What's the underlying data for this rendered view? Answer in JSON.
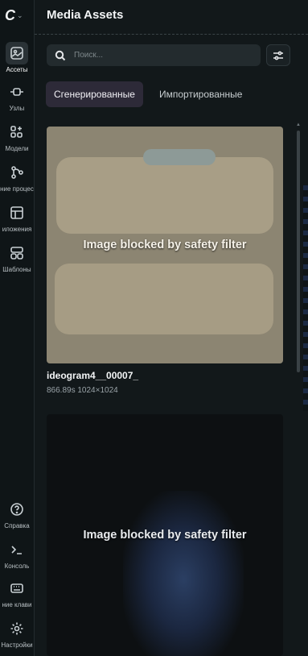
{
  "app": {
    "logo_text": "C",
    "chevron": "⌄"
  },
  "rail": {
    "items": [
      {
        "label": "Ассеты",
        "icon": "image-icon",
        "active": true
      },
      {
        "label": "Узлы",
        "icon": "node-icon"
      },
      {
        "label": "Модели",
        "icon": "models-icon"
      },
      {
        "label": "ние процес",
        "icon": "workflow-icon"
      },
      {
        "label": "иложения",
        "icon": "apps-icon"
      },
      {
        "label": "Шаблоны",
        "icon": "templates-icon"
      }
    ],
    "bottom_items": [
      {
        "label": "Справка",
        "icon": "help-icon"
      },
      {
        "label": "Консоль",
        "icon": "terminal-icon"
      },
      {
        "label": "ние клави",
        "icon": "keyboard-icon"
      },
      {
        "label": "Настройки",
        "icon": "settings-icon"
      }
    ]
  },
  "panel": {
    "title": "Media Assets",
    "search_placeholder": "Поиск...",
    "tabs": [
      {
        "label": "Сгенерированные",
        "active": true
      },
      {
        "label": "Импортированные",
        "active": false
      }
    ]
  },
  "assets": [
    {
      "overlay": "Image blocked by safety filter",
      "name": "ideogram4__00007_",
      "duration": "866.89s",
      "dimensions": "1024×1024"
    },
    {
      "overlay": "Image blocked by safety filter"
    }
  ]
}
